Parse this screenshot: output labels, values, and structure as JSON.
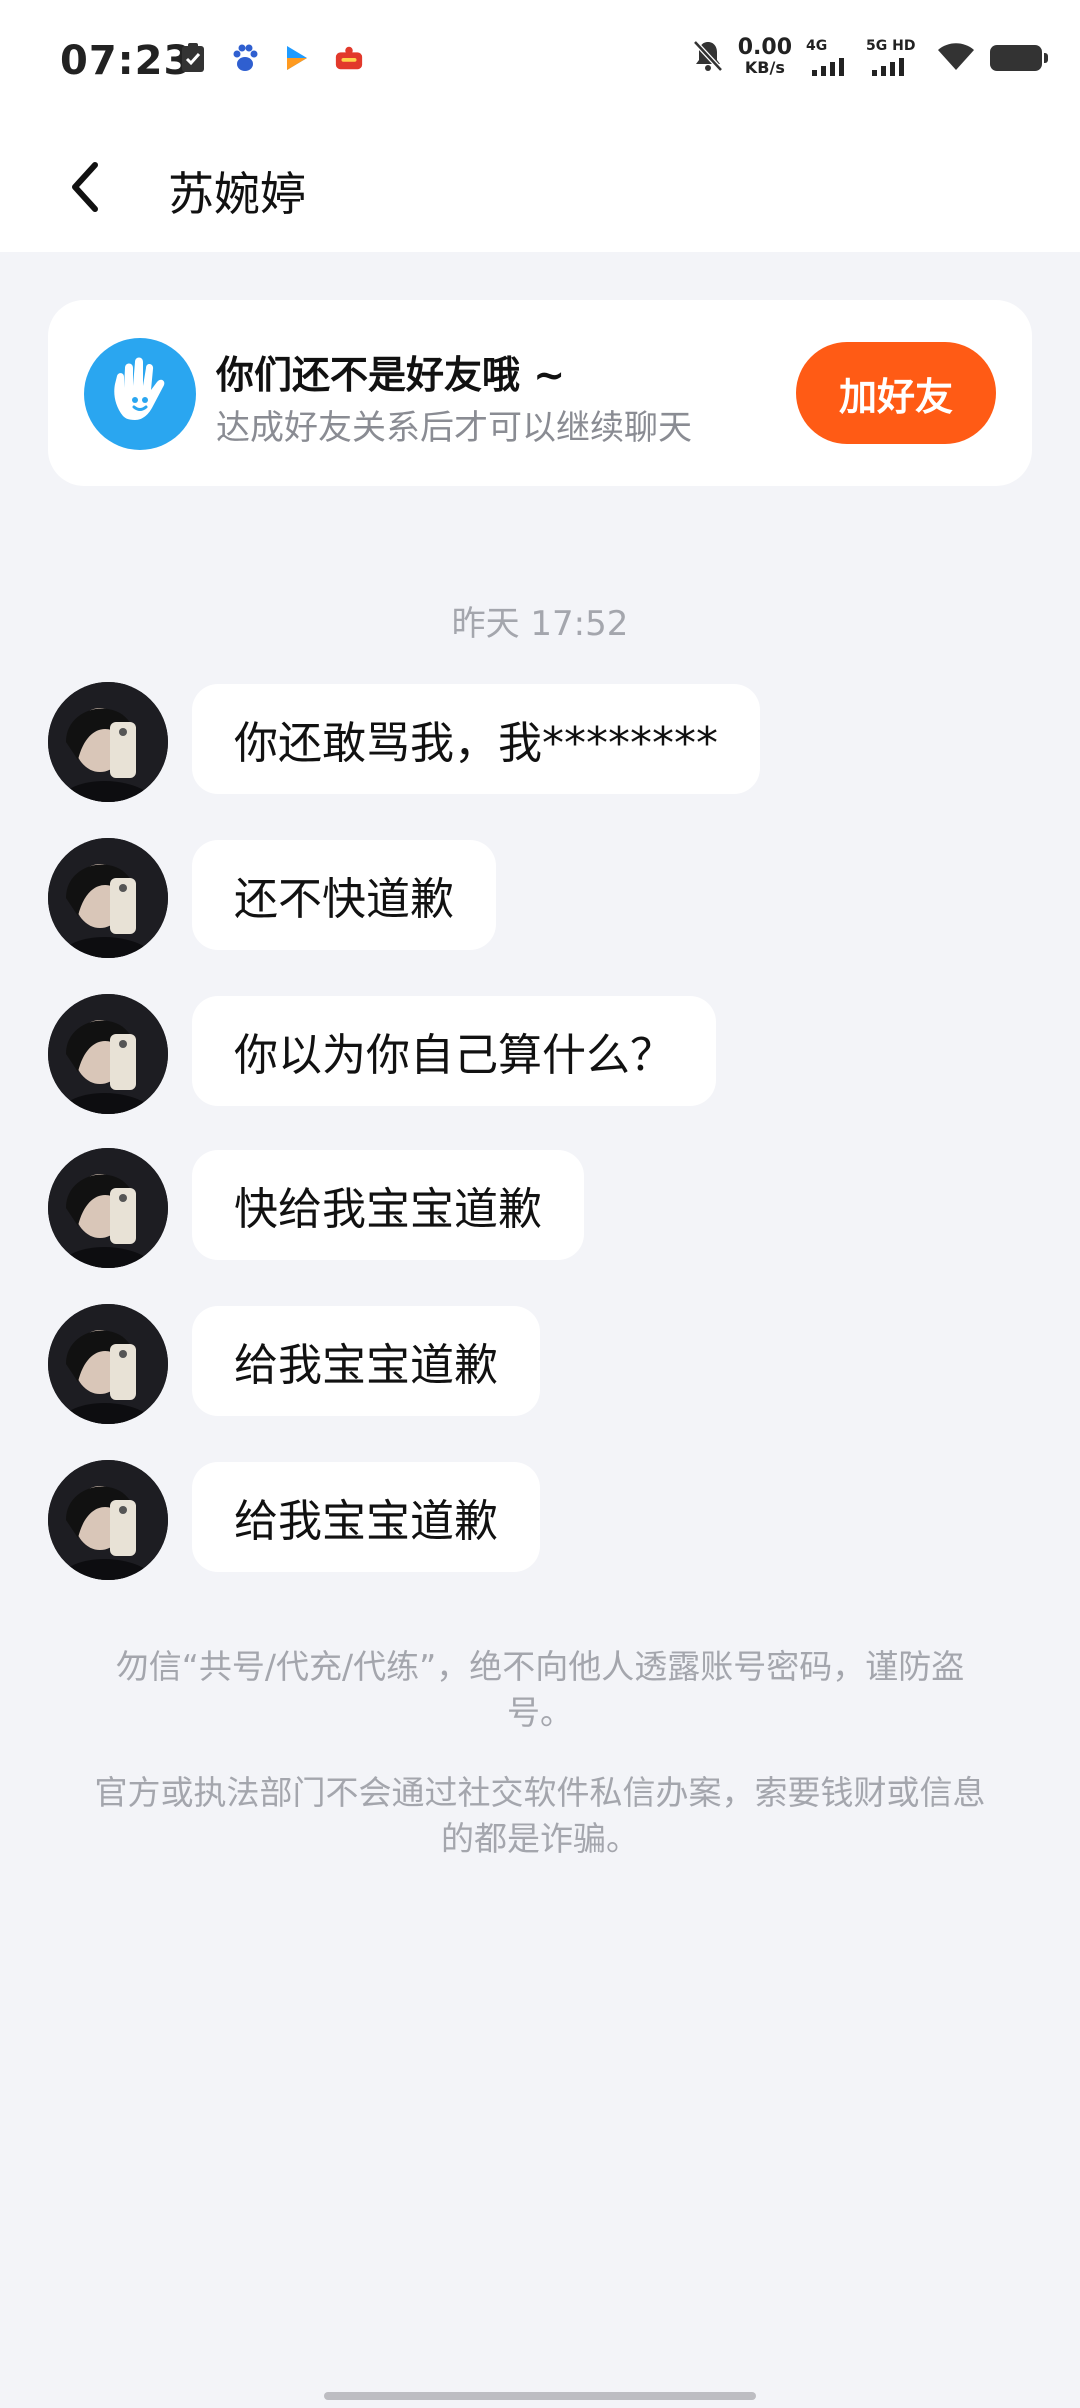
{
  "status_bar": {
    "time": "07:23",
    "net_speed_value": "0.00",
    "net_speed_unit": "KB/s",
    "sim1_label": "4G",
    "sim2_label": "5G HD",
    "icons": [
      "clipboard-check-icon",
      "baidu-paw-icon",
      "play-app-icon",
      "red-app-icon",
      "bell-off-icon",
      "wifi-icon",
      "battery-icon"
    ]
  },
  "header": {
    "title": "苏婉婷",
    "back_icon": "chevron-left-icon"
  },
  "friend_card": {
    "title": "你们还不是好友哦 ~",
    "subtitle": "达成好友关系后才可以继续聊天",
    "button_label": "加好友",
    "icon": "waving-hand-icon",
    "accent_color": "#ff5b15",
    "icon_bg_color": "#2aa6f0"
  },
  "chat": {
    "timestamp": "昨天 17:52",
    "messages": [
      {
        "text": "你还敢骂我，我********"
      },
      {
        "text": "还不快道歉"
      },
      {
        "text": "你以为你自己算什么？"
      },
      {
        "text": "快给我宝宝道歉"
      },
      {
        "text": "给我宝宝道歉"
      },
      {
        "text": "给我宝宝道歉"
      }
    ]
  },
  "notices": [
    "勿信“共号/代充/代练”，绝不向他人透露账号密码，谨防盗号。",
    "官方或执法部门不会通过社交软件私信办案，索要钱财或信息的都是诈骗。"
  ]
}
